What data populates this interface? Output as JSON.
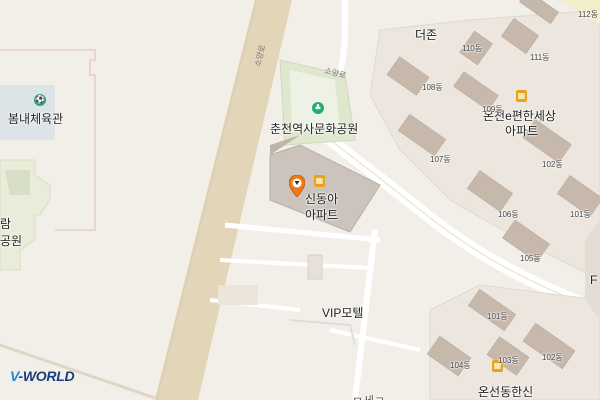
{
  "map": {
    "labels": {
      "sports_center": "봄내체육관",
      "park_side": "람",
      "park_side2": "공원",
      "deojon": "더존",
      "station_park": "춘천역사문화공원",
      "sindonga_line1": "신동아",
      "sindonga_line2": "아파트",
      "ecomfort_line1": "온천e편한세상",
      "ecomfort_line2": "아파트",
      "vip_motel": "VIP모텔",
      "onseon_hansin": "온선동한신",
      "road_soyang1": "소양로",
      "road_soyang2": "소양로",
      "edge_f": "F",
      "bottom_cut": "ㅁ세ㄹ"
    },
    "building_numbers": {
      "b112": "112동",
      "b110": "110동",
      "b111": "111동",
      "b108": "108동",
      "b109": "109동",
      "b107": "107동",
      "b102a": "102동",
      "b106": "106동",
      "b101a": "101동",
      "b105": "105동",
      "b101b": "101동",
      "b104": "104동",
      "b103": "103동",
      "b102b": "102동"
    },
    "icons": {
      "sports": "sports-facility-icon",
      "park": "park-icon",
      "apartment": "apartment-icon",
      "marker": "location-pin-icon"
    },
    "colors": {
      "background": "#f2efe9",
      "road": "#e3d6b8",
      "park": "#dfe8cf",
      "building": "#c6b8ad",
      "marker": "#f07b16"
    }
  },
  "logo": {
    "v": "V",
    "rest": "-WORLD"
  }
}
